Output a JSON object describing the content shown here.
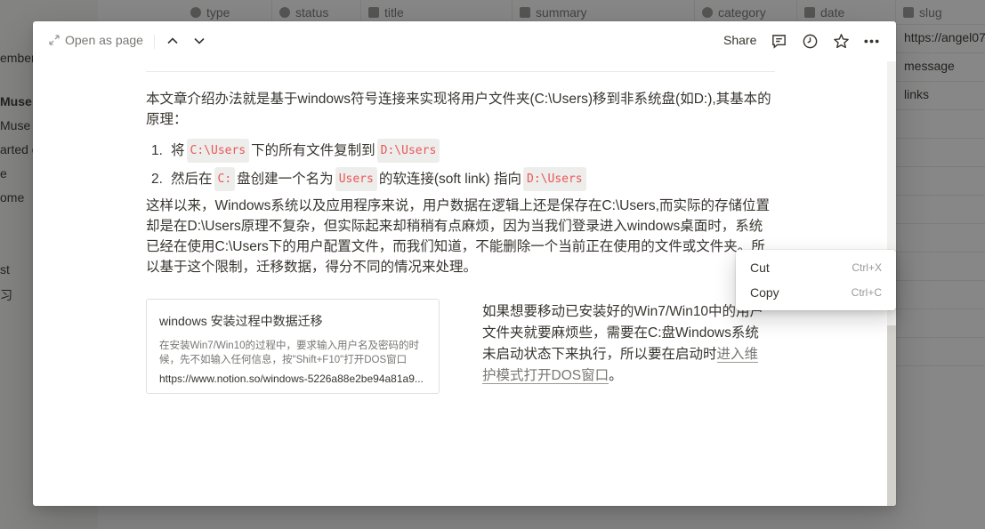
{
  "background": {
    "sidebar_items": [
      "ember",
      "Muse",
      "Muse",
      "arted o",
      "e",
      "ome",
      "st",
      "习"
    ],
    "columns": [
      {
        "label": "type",
        "icon": "select-icon"
      },
      {
        "label": "status",
        "icon": "select-icon"
      },
      {
        "label": "title",
        "icon": "text-icon"
      },
      {
        "label": "summary",
        "icon": "text-icon"
      },
      {
        "label": "category",
        "icon": "select-icon"
      },
      {
        "label": "date",
        "icon": "calendar-icon"
      },
      {
        "label": "slug",
        "icon": "text-icon"
      }
    ],
    "slug_cells": [
      "https://angel07",
      "message",
      "links"
    ]
  },
  "topbar": {
    "open_as_page": "Open as page",
    "share": "Share"
  },
  "body": {
    "intro": "本文章介绍办法就是基于windows符号连接来实现将用户文件夹(C:\\Users)移到非系统盘(如D:),其基本的原理：",
    "list": [
      {
        "num": "1.",
        "pre": "将",
        "code1": "C:\\Users",
        "mid": "下的所有文件复制到",
        "code2": "D:\\Users",
        "post": ""
      },
      {
        "num": "2.",
        "pre": "然后在",
        "code1": "C:",
        "mid": "盘创建一个名为",
        "code2": "Users",
        "mid2": "的软连接(soft link) 指向",
        "code3": "D:\\Users"
      }
    ],
    "explanation": "这样以来，Windows系统以及应用程序来说，用户数据在逻辑上还是保存在C:\\Users,而实际的存储位置却是在D:\\Users原理不复杂，但实际起来却稍稍有点麻烦，因为当我们登录进入windows桌面时，系统已经在使用C:\\Users下的用户配置文件，而我们知道，不能删除一个当前正在使用的文件或文件夹。所以基于这个限制，迁移数据，得分不同的情况来处理。",
    "bookmark": {
      "title": "windows 安装过程中数据迁移",
      "description": "在安装Win7/Win10的过程中，要求输入用户名及密码的时候，先不如输入任何信息，按\"Shift+F10\"打开DOS窗口",
      "url": "https://www.notion.so/windows-5226a88e2be94a81a9..."
    },
    "side_text": "如果想要移动已安装好的Win7/Win10中的用户文件夹就要麻烦些，需要在C:盘Windows系统未启动状态下来执行，所以要在启动时",
    "side_link": "进入维护模式打开DOS窗口",
    "side_end": "。"
  },
  "context_menu": {
    "items": [
      {
        "label": "Cut",
        "shortcut": "Ctrl+X"
      },
      {
        "label": "Copy",
        "shortcut": "Ctrl+C"
      }
    ]
  }
}
